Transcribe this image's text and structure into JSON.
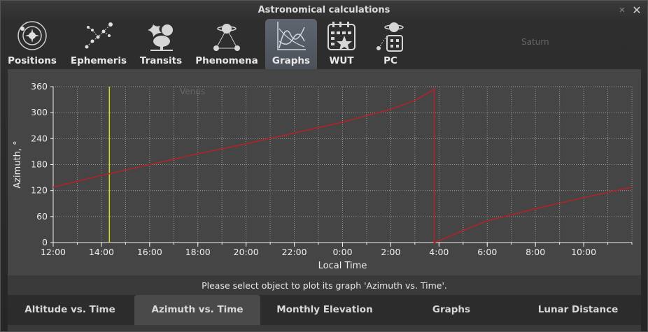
{
  "window": {
    "title": "Astronomical calculations",
    "close_symbol": "✕"
  },
  "tabs": [
    {
      "label": "Positions",
      "icon": "solar-system-icon"
    },
    {
      "label": "Ephemeris",
      "icon": "constellation-icon"
    },
    {
      "label": "Transits",
      "icon": "tree-and-star-icon"
    },
    {
      "label": "Phenomena",
      "icon": "planet-triangle-icon"
    },
    {
      "label": "Graphs",
      "icon": "graph-icon",
      "active": true
    },
    {
      "label": "WUT",
      "icon": "calendar-star-icon"
    },
    {
      "label": "PC",
      "icon": "planet-calculator-icon"
    }
  ],
  "background_labels": {
    "saturn": "Saturn",
    "venus": "Venus"
  },
  "chart_data": {
    "type": "line",
    "xlabel": "Local Time",
    "ylabel": "Azimuth, °",
    "ylim": [
      0,
      360
    ],
    "y_ticks": [
      "0",
      "60",
      "120",
      "180",
      "240",
      "300",
      "360"
    ],
    "x_ticks": [
      "12:00",
      "14:00",
      "16:00",
      "18:00",
      "20:00",
      "22:00",
      "0:00",
      "2:00",
      "4:00",
      "6:00",
      "8:00",
      "10:00"
    ],
    "x_hours_range": [
      12,
      36
    ],
    "grid": true,
    "current_time_hours": 14.33,
    "series": [
      {
        "color": "#b0232a",
        "points": [
          [
            12,
            128
          ],
          [
            14,
            155
          ],
          [
            16,
            180
          ],
          [
            18,
            205
          ],
          [
            20,
            228
          ],
          [
            22,
            253
          ],
          [
            24,
            278
          ],
          [
            26,
            308
          ],
          [
            27,
            328
          ],
          [
            27.75,
            352
          ],
          [
            27.8,
            357
          ],
          [
            27.8,
            0
          ],
          [
            28,
            4
          ],
          [
            29,
            28
          ],
          [
            30,
            50
          ],
          [
            32,
            78
          ],
          [
            34,
            104
          ],
          [
            36,
            128
          ]
        ]
      }
    ]
  },
  "status_text": "Please select object to plot its graph 'Azimuth vs. Time'.",
  "subtabs": [
    {
      "label": "Altitude vs. Time"
    },
    {
      "label": "Azimuth vs. Time",
      "active": true
    },
    {
      "label": "Monthly Elevation"
    },
    {
      "label": "Graphs"
    },
    {
      "label": "Lunar Distance"
    }
  ]
}
